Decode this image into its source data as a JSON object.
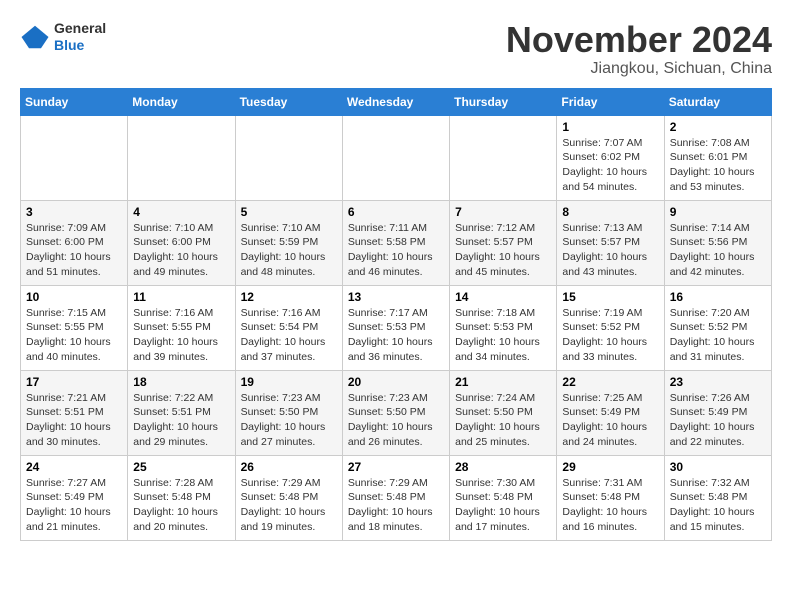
{
  "header": {
    "logo_general": "General",
    "logo_blue": "Blue",
    "month_title": "November 2024",
    "location": "Jiangkou, Sichuan, China"
  },
  "weekdays": [
    "Sunday",
    "Monday",
    "Tuesday",
    "Wednesday",
    "Thursday",
    "Friday",
    "Saturday"
  ],
  "weeks": [
    [
      {
        "day": "",
        "info": ""
      },
      {
        "day": "",
        "info": ""
      },
      {
        "day": "",
        "info": ""
      },
      {
        "day": "",
        "info": ""
      },
      {
        "day": "",
        "info": ""
      },
      {
        "day": "1",
        "info": "Sunrise: 7:07 AM\nSunset: 6:02 PM\nDaylight: 10 hours and 54 minutes."
      },
      {
        "day": "2",
        "info": "Sunrise: 7:08 AM\nSunset: 6:01 PM\nDaylight: 10 hours and 53 minutes."
      }
    ],
    [
      {
        "day": "3",
        "info": "Sunrise: 7:09 AM\nSunset: 6:00 PM\nDaylight: 10 hours and 51 minutes."
      },
      {
        "day": "4",
        "info": "Sunrise: 7:10 AM\nSunset: 6:00 PM\nDaylight: 10 hours and 49 minutes."
      },
      {
        "day": "5",
        "info": "Sunrise: 7:10 AM\nSunset: 5:59 PM\nDaylight: 10 hours and 48 minutes."
      },
      {
        "day": "6",
        "info": "Sunrise: 7:11 AM\nSunset: 5:58 PM\nDaylight: 10 hours and 46 minutes."
      },
      {
        "day": "7",
        "info": "Sunrise: 7:12 AM\nSunset: 5:57 PM\nDaylight: 10 hours and 45 minutes."
      },
      {
        "day": "8",
        "info": "Sunrise: 7:13 AM\nSunset: 5:57 PM\nDaylight: 10 hours and 43 minutes."
      },
      {
        "day": "9",
        "info": "Sunrise: 7:14 AM\nSunset: 5:56 PM\nDaylight: 10 hours and 42 minutes."
      }
    ],
    [
      {
        "day": "10",
        "info": "Sunrise: 7:15 AM\nSunset: 5:55 PM\nDaylight: 10 hours and 40 minutes."
      },
      {
        "day": "11",
        "info": "Sunrise: 7:16 AM\nSunset: 5:55 PM\nDaylight: 10 hours and 39 minutes."
      },
      {
        "day": "12",
        "info": "Sunrise: 7:16 AM\nSunset: 5:54 PM\nDaylight: 10 hours and 37 minutes."
      },
      {
        "day": "13",
        "info": "Sunrise: 7:17 AM\nSunset: 5:53 PM\nDaylight: 10 hours and 36 minutes."
      },
      {
        "day": "14",
        "info": "Sunrise: 7:18 AM\nSunset: 5:53 PM\nDaylight: 10 hours and 34 minutes."
      },
      {
        "day": "15",
        "info": "Sunrise: 7:19 AM\nSunset: 5:52 PM\nDaylight: 10 hours and 33 minutes."
      },
      {
        "day": "16",
        "info": "Sunrise: 7:20 AM\nSunset: 5:52 PM\nDaylight: 10 hours and 31 minutes."
      }
    ],
    [
      {
        "day": "17",
        "info": "Sunrise: 7:21 AM\nSunset: 5:51 PM\nDaylight: 10 hours and 30 minutes."
      },
      {
        "day": "18",
        "info": "Sunrise: 7:22 AM\nSunset: 5:51 PM\nDaylight: 10 hours and 29 minutes."
      },
      {
        "day": "19",
        "info": "Sunrise: 7:23 AM\nSunset: 5:50 PM\nDaylight: 10 hours and 27 minutes."
      },
      {
        "day": "20",
        "info": "Sunrise: 7:23 AM\nSunset: 5:50 PM\nDaylight: 10 hours and 26 minutes."
      },
      {
        "day": "21",
        "info": "Sunrise: 7:24 AM\nSunset: 5:50 PM\nDaylight: 10 hours and 25 minutes."
      },
      {
        "day": "22",
        "info": "Sunrise: 7:25 AM\nSunset: 5:49 PM\nDaylight: 10 hours and 24 minutes."
      },
      {
        "day": "23",
        "info": "Sunrise: 7:26 AM\nSunset: 5:49 PM\nDaylight: 10 hours and 22 minutes."
      }
    ],
    [
      {
        "day": "24",
        "info": "Sunrise: 7:27 AM\nSunset: 5:49 PM\nDaylight: 10 hours and 21 minutes."
      },
      {
        "day": "25",
        "info": "Sunrise: 7:28 AM\nSunset: 5:48 PM\nDaylight: 10 hours and 20 minutes."
      },
      {
        "day": "26",
        "info": "Sunrise: 7:29 AM\nSunset: 5:48 PM\nDaylight: 10 hours and 19 minutes."
      },
      {
        "day": "27",
        "info": "Sunrise: 7:29 AM\nSunset: 5:48 PM\nDaylight: 10 hours and 18 minutes."
      },
      {
        "day": "28",
        "info": "Sunrise: 7:30 AM\nSunset: 5:48 PM\nDaylight: 10 hours and 17 minutes."
      },
      {
        "day": "29",
        "info": "Sunrise: 7:31 AM\nSunset: 5:48 PM\nDaylight: 10 hours and 16 minutes."
      },
      {
        "day": "30",
        "info": "Sunrise: 7:32 AM\nSunset: 5:48 PM\nDaylight: 10 hours and 15 minutes."
      }
    ]
  ]
}
